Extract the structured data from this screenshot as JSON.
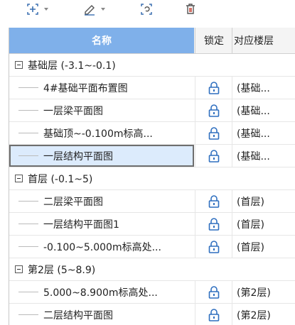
{
  "toolbar": {
    "icons": [
      "add-drawing-icon",
      "edit-icon",
      "replace-icon",
      "delete-icon"
    ]
  },
  "table": {
    "headers": {
      "name": "名称",
      "lock": "锁定",
      "floor": "对应楼层"
    },
    "rows": [
      {
        "type": "group",
        "label": "基础层 (-3.1~-0.1)"
      },
      {
        "type": "item",
        "label": "4#基础平面布置图",
        "floor": "(基础..."
      },
      {
        "type": "item",
        "label": "一层梁平面图",
        "floor": "(基础..."
      },
      {
        "type": "item",
        "label": "基础顶~-0.100m标高...",
        "floor": "(基础..."
      },
      {
        "type": "item",
        "label": "一层结构平面图",
        "floor": "(基础...",
        "selected": true
      },
      {
        "type": "group",
        "label": "首层 (-0.1~5)"
      },
      {
        "type": "item",
        "label": "二层梁平面图",
        "floor": "(首层)"
      },
      {
        "type": "item",
        "label": "一层结构平面图1",
        "floor": "(首层)"
      },
      {
        "type": "item",
        "label": "-0.100~5.000m标高处...",
        "floor": "(首层)"
      },
      {
        "type": "group",
        "label": "第2层 (5~8.9)"
      },
      {
        "type": "item",
        "label": "5.000~8.900m标高处...",
        "floor": "(第2层)"
      },
      {
        "type": "item",
        "label": "二层结构平面图",
        "floor": "(第2层)"
      }
    ]
  }
}
